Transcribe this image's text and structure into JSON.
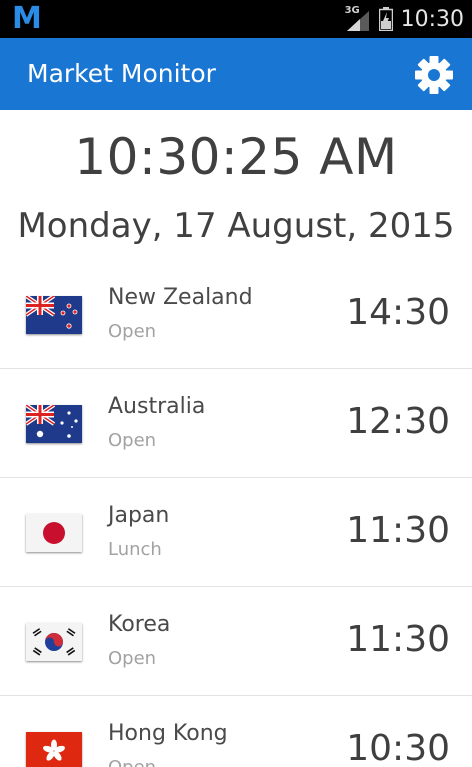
{
  "status_bar": {
    "app_icon_letter": "M",
    "network": "3G",
    "time": "10:30"
  },
  "app_bar": {
    "title": "Market Monitor",
    "settings_icon": "gear-icon"
  },
  "clock": {
    "time": "10:30:25 AM",
    "date": "Monday, 17 August, 2015"
  },
  "markets": [
    {
      "name": "New Zealand",
      "status": "Open",
      "time": "14:30",
      "flag": "new-zealand-flag"
    },
    {
      "name": "Australia",
      "status": "Open",
      "time": "12:30",
      "flag": "australia-flag"
    },
    {
      "name": "Japan",
      "status": "Lunch",
      "time": "11:30",
      "flag": "japan-flag"
    },
    {
      "name": "Korea",
      "status": "Open",
      "time": "11:30",
      "flag": "korea-flag"
    },
    {
      "name": "Hong Kong",
      "status": "Open",
      "time": "10:30",
      "flag": "hong-kong-flag"
    }
  ],
  "colors": {
    "app_bar": "#1976d2",
    "status_bar": "#000000",
    "logo": "#2b8ce6"
  }
}
